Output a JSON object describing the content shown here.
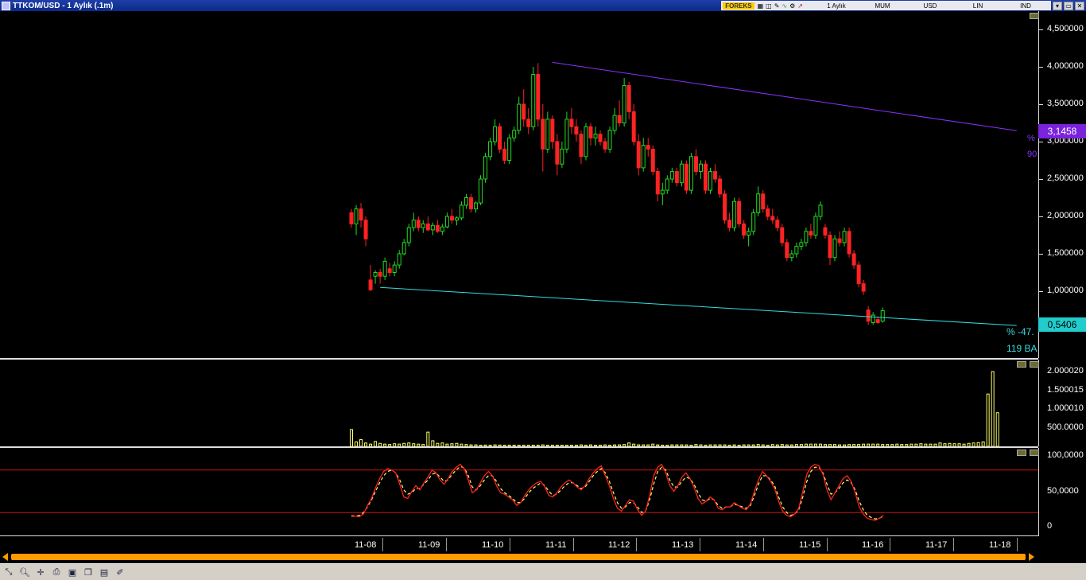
{
  "window": {
    "title": "TTKOM/USD - 1 Aylık (.1m)",
    "source_badge": "FOREKS",
    "menu": [
      "1 Aylık",
      "MUM",
      "USD",
      "LIN",
      "IND"
    ],
    "controls": [
      "▾",
      "▭",
      "✕"
    ]
  },
  "colors": {
    "up_candle": "#22dd22",
    "down_candle": "#ff2222",
    "trend_upper": "#8833ff",
    "trend_lower": "#33dddd",
    "volume": "#ffff66",
    "oscillator_fast": "#ff2222",
    "oscillator_slow": "#ffff66",
    "scroll": "#ff9a00"
  },
  "price_axis": {
    "labels": [
      "4,500000",
      "4,000000",
      "3,500000",
      "3,000000",
      "2,500000",
      "2,000000",
      "1,500000",
      "1,000000"
    ],
    "values": [
      4.5,
      4.0,
      3.5,
      3.0,
      2.5,
      2.0,
      1.5,
      1.0
    ],
    "upper_marker": "3,1458",
    "lower_marker": "0,5406"
  },
  "annotations": {
    "upper_pct": "%",
    "upper_bars": "90",
    "lower_pct": "% -47.",
    "lower_bars": "119 BA"
  },
  "volume_axis": {
    "labels": [
      "2.000020",
      "1.500015",
      "1.000010",
      "500.0000"
    ],
    "values": [
      2000020,
      1500015,
      1000010,
      500000
    ]
  },
  "oscillator_axis": {
    "labels": [
      "100,0000",
      "50,0000",
      "0"
    ],
    "values": [
      100,
      50,
      0
    ],
    "upper_level": 80,
    "lower_level": 20
  },
  "time_axis": {
    "labels": [
      "11-08",
      "11-09",
      "11-10",
      "11-11",
      "11-12",
      "11-13",
      "11-14",
      "11-15",
      "11-16",
      "11-17",
      "11-18"
    ]
  },
  "toolbar": {
    "tools": [
      "cursor-tool",
      "zoom-tool",
      "crosshair-tool",
      "print-tool",
      "save-tool",
      "copy-tool",
      "settings-tool",
      "draw-tool"
    ]
  },
  "chart_data": {
    "type": "candlestick",
    "title": "TTKOM/USD - 1 Aylık (.1m)",
    "ylim": [
      0.6,
      4.6
    ],
    "trendlines": [
      {
        "start_bar": 42,
        "start_value": 4.06,
        "end_bar": 139,
        "end_value": 3.1458
      },
      {
        "start_bar": 6,
        "start_value": 1.05,
        "end_bar": 139,
        "end_value": 0.5406
      }
    ],
    "candles": [
      [
        2.05,
        2.1,
        1.85,
        1.9
      ],
      [
        1.9,
        2.15,
        1.75,
        2.1
      ],
      [
        2.1,
        2.18,
        1.85,
        1.95
      ],
      [
        1.95,
        2.0,
        1.6,
        1.7
      ],
      [
        1.15,
        1.35,
        1.0,
        1.02
      ],
      [
        1.2,
        1.28,
        1.1,
        1.25
      ],
      [
        1.25,
        1.3,
        1.1,
        1.2
      ],
      [
        1.2,
        1.45,
        1.15,
        1.4
      ],
      [
        1.3,
        1.38,
        1.2,
        1.25
      ],
      [
        1.25,
        1.4,
        1.2,
        1.35
      ],
      [
        1.35,
        1.55,
        1.3,
        1.5
      ],
      [
        1.5,
        1.7,
        1.48,
        1.65
      ],
      [
        1.65,
        1.9,
        1.6,
        1.85
      ],
      [
        1.85,
        2.05,
        1.8,
        1.95
      ],
      [
        1.95,
        2.0,
        1.8,
        1.85
      ],
      [
        1.85,
        1.95,
        1.78,
        1.9
      ],
      [
        1.9,
        2.0,
        1.8,
        1.82
      ],
      [
        1.82,
        1.92,
        1.75,
        1.88
      ],
      [
        1.88,
        1.95,
        1.78,
        1.8
      ],
      [
        1.8,
        1.9,
        1.75,
        1.86
      ],
      [
        1.86,
        2.05,
        1.84,
        2.0
      ],
      [
        2.0,
        2.1,
        1.9,
        1.95
      ],
      [
        1.95,
        2.0,
        1.88,
        1.98
      ],
      [
        1.98,
        2.2,
        1.95,
        2.15
      ],
      [
        2.15,
        2.3,
        2.1,
        2.25
      ],
      [
        2.25,
        2.3,
        2.05,
        2.1
      ],
      [
        2.1,
        2.2,
        2.05,
        2.18
      ],
      [
        2.18,
        2.55,
        2.15,
        2.5
      ],
      [
        2.5,
        2.85,
        2.45,
        2.8
      ],
      [
        2.8,
        3.05,
        2.75,
        3.0
      ],
      [
        3.0,
        3.3,
        2.95,
        3.2
      ],
      [
        3.2,
        3.25,
        2.85,
        2.9
      ],
      [
        2.9,
        3.0,
        2.7,
        2.75
      ],
      [
        2.75,
        3.1,
        2.7,
        3.05
      ],
      [
        3.05,
        3.2,
        3.0,
        3.15
      ],
      [
        3.15,
        3.6,
        3.1,
        3.5
      ],
      [
        3.5,
        3.7,
        3.2,
        3.3
      ],
      [
        3.3,
        3.45,
        3.1,
        3.2
      ],
      [
        3.2,
        4.0,
        3.15,
        3.9
      ],
      [
        3.9,
        4.05,
        3.2,
        3.3
      ],
      [
        3.3,
        3.5,
        2.6,
        2.9
      ],
      [
        2.9,
        3.4,
        2.85,
        3.3
      ],
      [
        3.3,
        3.35,
        2.9,
        3.0
      ],
      [
        3.0,
        3.1,
        2.55,
        2.7
      ],
      [
        2.7,
        3.0,
        2.65,
        2.9
      ],
      [
        2.9,
        3.4,
        2.85,
        3.3
      ],
      [
        3.3,
        3.45,
        3.1,
        3.2
      ],
      [
        3.2,
        3.3,
        3.0,
        3.1
      ],
      [
        3.1,
        3.15,
        2.7,
        2.8
      ],
      [
        2.8,
        3.25,
        2.75,
        3.2
      ],
      [
        3.2,
        3.25,
        2.95,
        3.05
      ],
      [
        3.05,
        3.2,
        2.95,
        3.1
      ],
      [
        3.1,
        3.15,
        2.95,
        3.0
      ],
      [
        3.0,
        3.05,
        2.85,
        2.9
      ],
      [
        2.9,
        3.2,
        2.85,
        3.15
      ],
      [
        3.15,
        3.45,
        3.1,
        3.35
      ],
      [
        3.35,
        3.55,
        3.2,
        3.25
      ],
      [
        3.25,
        3.85,
        3.2,
        3.75
      ],
      [
        3.75,
        3.8,
        3.3,
        3.4
      ],
      [
        3.4,
        3.5,
        2.95,
        3.0
      ],
      [
        3.0,
        3.1,
        2.55,
        2.65
      ],
      [
        2.65,
        3.05,
        2.6,
        2.95
      ],
      [
        2.95,
        3.05,
        2.8,
        2.9
      ],
      [
        2.9,
        2.95,
        2.55,
        2.6
      ],
      [
        2.6,
        2.65,
        2.2,
        2.3
      ],
      [
        2.3,
        2.45,
        2.15,
        2.35
      ],
      [
        2.35,
        2.55,
        2.3,
        2.5
      ],
      [
        2.5,
        2.65,
        2.45,
        2.6
      ],
      [
        2.6,
        2.65,
        2.4,
        2.45
      ],
      [
        2.45,
        2.75,
        2.4,
        2.7
      ],
      [
        2.7,
        2.75,
        2.3,
        2.35
      ],
      [
        2.35,
        2.85,
        2.3,
        2.8
      ],
      [
        2.8,
        2.9,
        2.55,
        2.6
      ],
      [
        2.6,
        2.75,
        2.5,
        2.7
      ],
      [
        2.7,
        2.75,
        2.3,
        2.35
      ],
      [
        2.35,
        2.65,
        2.3,
        2.6
      ],
      [
        2.6,
        2.7,
        2.45,
        2.5
      ],
      [
        2.5,
        2.55,
        2.25,
        2.3
      ],
      [
        2.3,
        2.35,
        1.9,
        1.95
      ],
      [
        1.95,
        2.05,
        1.8,
        1.85
      ],
      [
        1.85,
        2.25,
        1.8,
        2.2
      ],
      [
        2.2,
        2.25,
        1.85,
        1.9
      ],
      [
        1.9,
        1.95,
        1.7,
        1.75
      ],
      [
        1.75,
        1.85,
        1.6,
        1.8
      ],
      [
        1.8,
        2.1,
        1.75,
        2.05
      ],
      [
        2.05,
        2.4,
        2.0,
        2.3
      ],
      [
        2.3,
        2.35,
        2.05,
        2.1
      ],
      [
        2.1,
        2.15,
        1.95,
        2.0
      ],
      [
        2.0,
        2.1,
        1.9,
        1.95
      ],
      [
        1.95,
        2.0,
        1.8,
        1.85
      ],
      [
        1.85,
        1.9,
        1.6,
        1.65
      ],
      [
        1.65,
        1.7,
        1.4,
        1.45
      ],
      [
        1.45,
        1.55,
        1.4,
        1.5
      ],
      [
        1.5,
        1.65,
        1.45,
        1.6
      ],
      [
        1.6,
        1.7,
        1.55,
        1.65
      ],
      [
        1.65,
        1.85,
        1.6,
        1.8
      ],
      [
        1.8,
        1.9,
        1.7,
        1.75
      ],
      [
        1.75,
        2.05,
        1.7,
        2.0
      ],
      [
        2.0,
        2.2,
        1.95,
        2.15
      ],
      [
        1.85,
        1.9,
        1.7,
        1.75
      ],
      [
        1.75,
        1.8,
        1.35,
        1.45
      ],
      [
        1.45,
        1.75,
        1.4,
        1.7
      ],
      [
        1.7,
        1.8,
        1.6,
        1.65
      ],
      [
        1.65,
        1.85,
        1.6,
        1.8
      ],
      [
        1.8,
        1.85,
        1.45,
        1.5
      ],
      [
        1.5,
        1.55,
        1.3,
        1.35
      ],
      [
        1.35,
        1.4,
        1.05,
        1.1
      ],
      [
        1.1,
        1.15,
        0.95,
        1.0
      ],
      [
        0.75,
        0.8,
        0.55,
        0.6
      ],
      [
        0.58,
        0.72,
        0.55,
        0.68
      ],
      [
        0.62,
        0.66,
        0.56,
        0.58
      ],
      [
        0.6,
        0.78,
        0.58,
        0.74
      ]
    ],
    "volume": [
      450000,
      120000,
      180000,
      90000,
      60000,
      130000,
      80000,
      60000,
      50000,
      70000,
      60000,
      80000,
      90000,
      70000,
      60000,
      50000,
      380000,
      150000,
      80000,
      90000,
      60000,
      70000,
      80000,
      60000,
      50000,
      40000,
      40000,
      30000,
      35000,
      30000,
      40000,
      35000,
      30000,
      30000,
      30000,
      30000,
      30000,
      30000,
      30000,
      30000,
      40000,
      30000,
      30000,
      30000,
      30000,
      30000,
      30000,
      30000,
      40000,
      30000,
      40000,
      30000,
      30000,
      40000,
      30000,
      40000,
      40000,
      50000,
      90000,
      60000,
      40000,
      40000,
      40000,
      60000,
      40000,
      30000,
      30000,
      40000,
      40000,
      40000,
      40000,
      30000,
      50000,
      40000,
      30000,
      40000,
      40000,
      40000,
      40000,
      30000,
      40000,
      30000,
      40000,
      40000,
      40000,
      50000,
      40000,
      30000,
      50000,
      40000,
      50000,
      40000,
      40000,
      50000,
      50000,
      60000,
      60000,
      60000,
      60000,
      50000,
      50000,
      50000,
      40000,
      40000,
      50000,
      50000,
      50000,
      60000,
      60000,
      60000,
      60000,
      50000,
      50000,
      50000,
      60000,
      50000,
      50000,
      60000,
      60000,
      70000,
      60000,
      60000,
      60000,
      90000,
      70000,
      80000,
      70000,
      70000,
      60000,
      80000,
      90000,
      100000,
      120000,
      1400000,
      2000020,
      900000
    ],
    "oscillator": {
      "fast": [
        16,
        15,
        14,
        18,
        30,
        40,
        55,
        68,
        78,
        82,
        80,
        76,
        60,
        42,
        40,
        50,
        58,
        52,
        62,
        70,
        80,
        76,
        66,
        60,
        68,
        78,
        84,
        88,
        82,
        66,
        48,
        52,
        62,
        72,
        78,
        72,
        58,
        48,
        46,
        42,
        38,
        30,
        34,
        44,
        52,
        58,
        62,
        64,
        56,
        44,
        42,
        48,
        56,
        62,
        66,
        62,
        56,
        52,
        58,
        68,
        76,
        82,
        86,
        72,
        58,
        40,
        26,
        22,
        30,
        38,
        36,
        24,
        16,
        22,
        44,
        72,
        84,
        88,
        76,
        58,
        50,
        58,
        70,
        76,
        68,
        56,
        40,
        32,
        36,
        42,
        38,
        26,
        24,
        28,
        28,
        34,
        30,
        26,
        24,
        32,
        50,
        66,
        78,
        72,
        64,
        54,
        36,
        22,
        16,
        14,
        18,
        26,
        50,
        74,
        84,
        88,
        86,
        74,
        52,
        38,
        48,
        58,
        68,
        72,
        64,
        48,
        28,
        18,
        12,
        10,
        9,
        12,
        16
      ],
      "slow": [
        15,
        15,
        16,
        20,
        28,
        38,
        50,
        62,
        72,
        78,
        80,
        76,
        66,
        52,
        46,
        48,
        54,
        54,
        60,
        66,
        74,
        76,
        70,
        64,
        66,
        74,
        80,
        85,
        83,
        72,
        56,
        52,
        58,
        66,
        72,
        72,
        64,
        54,
        48,
        44,
        40,
        34,
        34,
        40,
        48,
        54,
        58,
        62,
        58,
        50,
        44,
        46,
        52,
        58,
        62,
        62,
        58,
        54,
        56,
        64,
        72,
        78,
        82,
        76,
        64,
        48,
        34,
        26,
        28,
        34,
        34,
        28,
        20,
        22,
        38,
        60,
        78,
        84,
        80,
        66,
        56,
        56,
        64,
        70,
        68,
        60,
        48,
        38,
        36,
        40,
        38,
        30,
        26,
        28,
        28,
        32,
        30,
        28,
        26,
        30,
        44,
        60,
        72,
        72,
        66,
        58,
        42,
        28,
        20,
        16,
        18,
        24,
        42,
        64,
        78,
        84,
        84,
        76,
        60,
        46,
        48,
        54,
        62,
        66,
        62,
        52,
        36,
        24,
        16,
        13,
        11,
        12,
        15
      ]
    }
  }
}
